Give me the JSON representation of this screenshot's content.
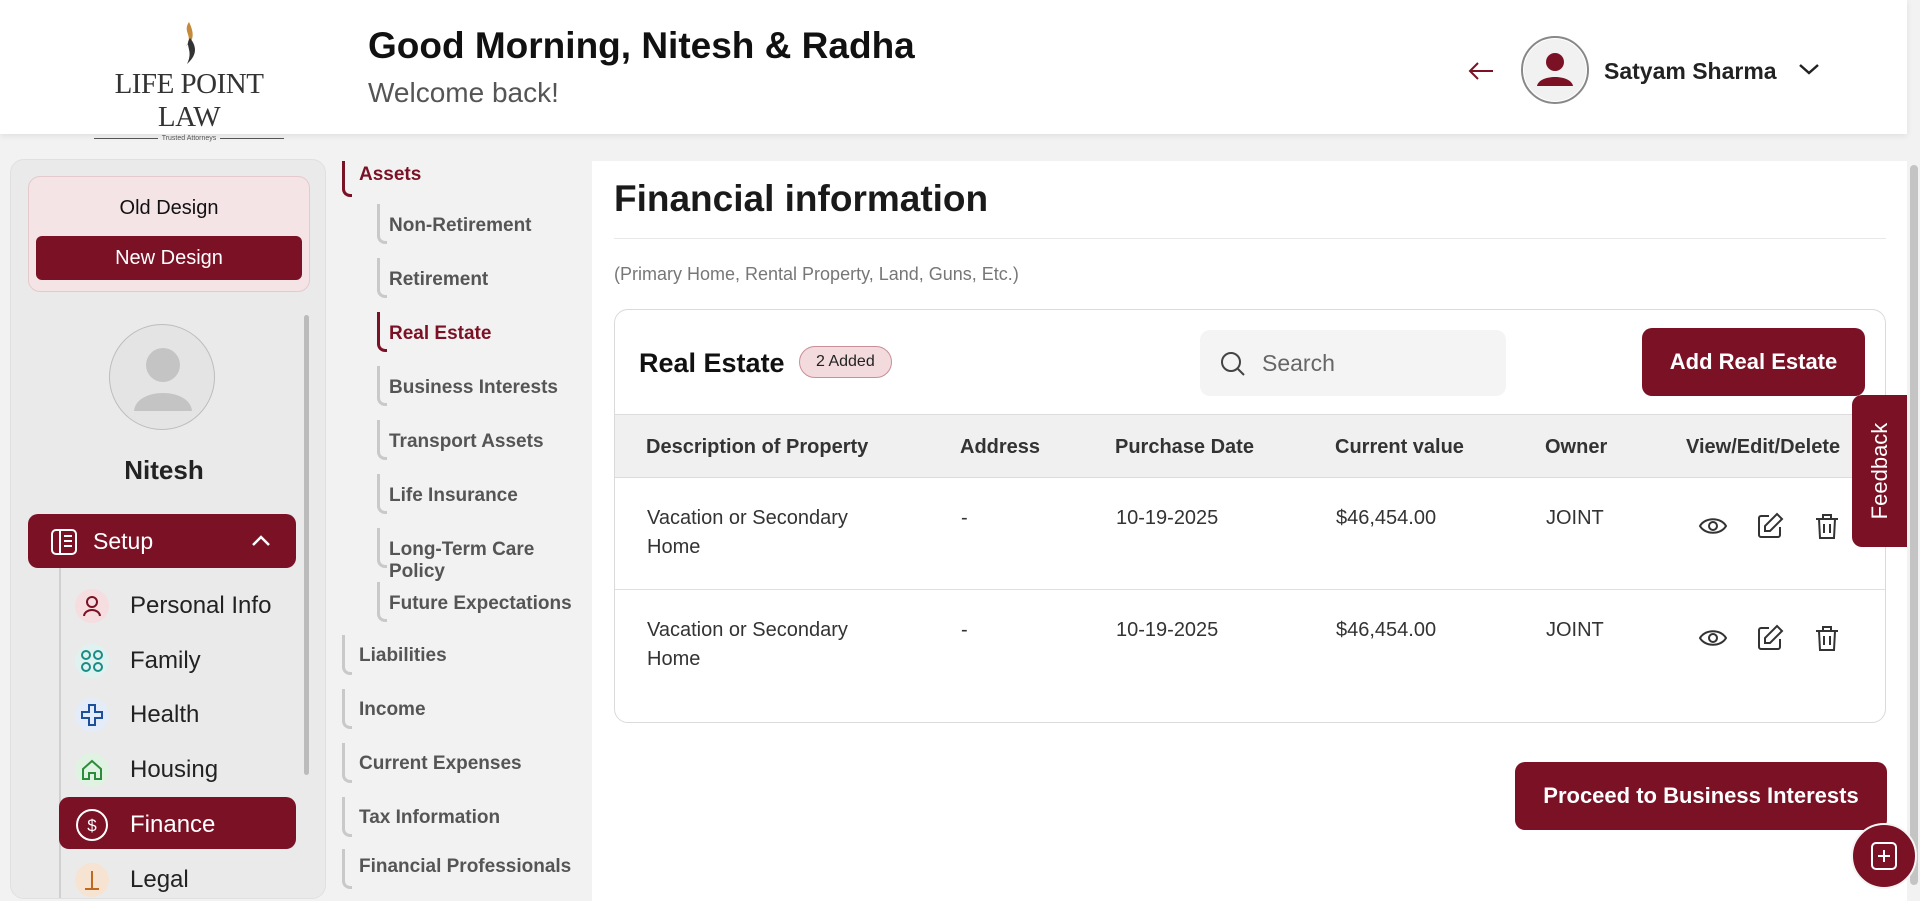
{
  "header": {
    "brand": "LIFE POINT LAW",
    "brand_tagline": "Trusted Attorneys",
    "greeting": "Good Morning, Nitesh & Radha",
    "subtitle": "Welcome back!",
    "user_name": "Satyam Sharma"
  },
  "sidebar": {
    "old_design": "Old Design",
    "new_design": "New Design",
    "profile_name": "Nitesh",
    "setup_label": "Setup",
    "items": [
      {
        "label": "Personal Info",
        "icon": "person-icon"
      },
      {
        "label": "Family",
        "icon": "family-icon"
      },
      {
        "label": "Health",
        "icon": "health-cross-icon"
      },
      {
        "label": "Housing",
        "icon": "home-icon"
      },
      {
        "label": "Finance",
        "icon": "dollar-icon",
        "active": true
      },
      {
        "label": "Legal",
        "icon": "legal-icon"
      }
    ]
  },
  "subnav": {
    "assets": "Assets",
    "asset_items": [
      "Non-Retirement",
      "Retirement",
      "Real Estate",
      "Business Interests",
      "Transport Assets",
      "Life Insurance",
      "Long-Term Care Policy",
      "Future Expectations"
    ],
    "sections": [
      "Liabilities",
      "Income",
      "Current Expenses",
      "Tax Information",
      "Financial Professionals"
    ]
  },
  "main": {
    "title": "Financial information",
    "subtitle": "(Primary Home, Rental Property, Land, Guns, Etc.)",
    "card_title": "Real Estate",
    "badge": "2 Added",
    "search_placeholder": "Search",
    "add_button": "Add Real Estate",
    "columns": [
      "Description of Property",
      "Address",
      "Purchase Date",
      "Current value",
      "Owner",
      "View/Edit/Delete"
    ],
    "rows": [
      {
        "description": "Vacation or Secondary Home",
        "address": "-",
        "date": "10-19-2025",
        "value": "$46,454.00",
        "owner": "JOINT"
      },
      {
        "description": "Vacation or Secondary Home",
        "address": "-",
        "date": "10-19-2025",
        "value": "$46,454.00",
        "owner": "JOINT"
      }
    ],
    "proceed_button": "Proceed to Business Interests",
    "feedback": "Feedback"
  },
  "colors": {
    "brand": "#7b1125",
    "badge_bg": "#f3dadd"
  }
}
